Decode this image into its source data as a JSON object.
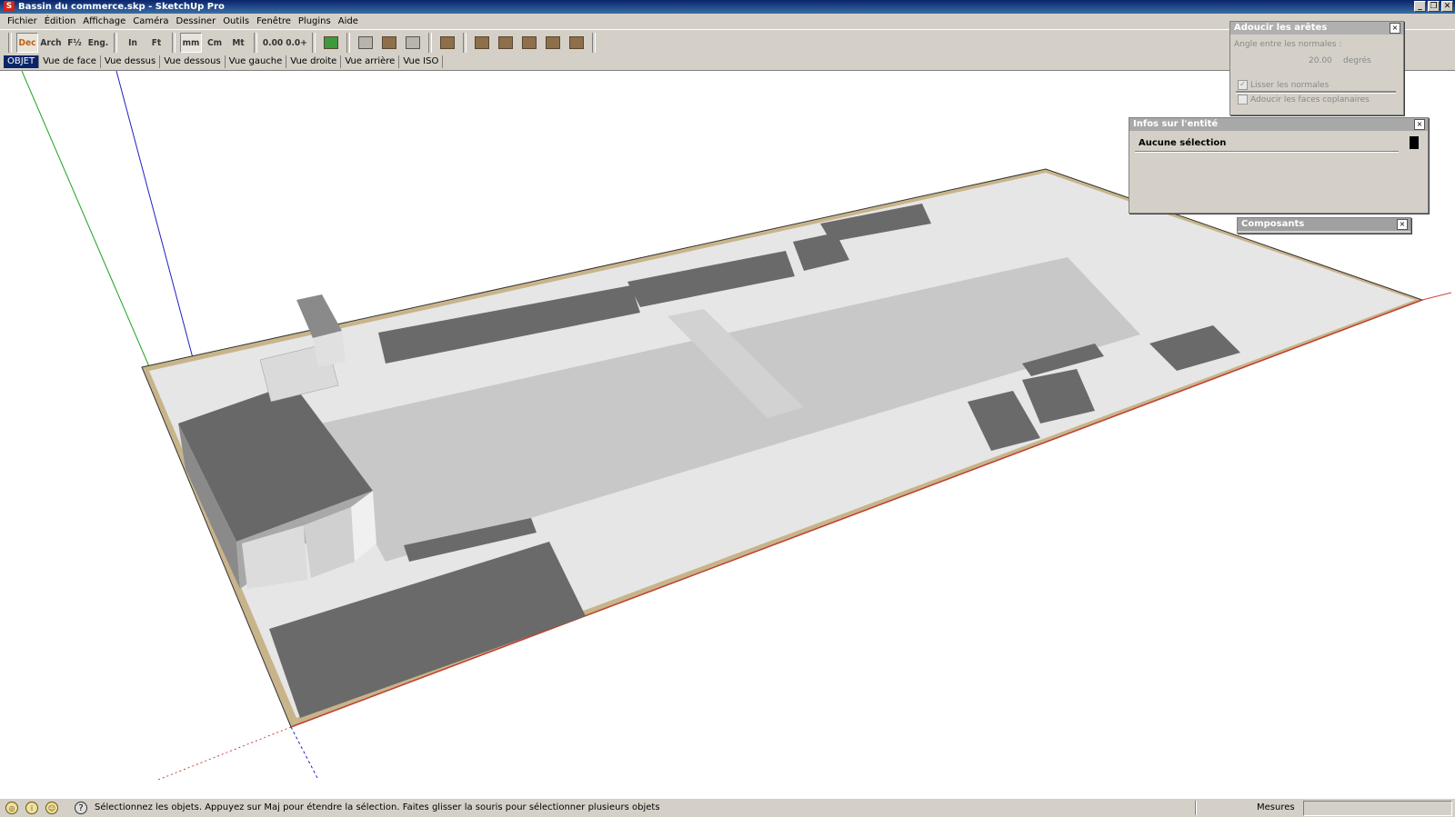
{
  "window": {
    "title": "Bassin du commerce.skp - SketchUp Pro"
  },
  "menu": [
    "Fichier",
    "Édition",
    "Affichage",
    "Caméra",
    "Dessiner",
    "Outils",
    "Fenêtre",
    "Plugins",
    "Aide"
  ],
  "toolbar": {
    "units": [
      {
        "label": "Dec",
        "active": true
      },
      {
        "label": "Arch"
      },
      {
        "label": "F½"
      },
      {
        "label": "Eng."
      },
      {
        "label": "In"
      },
      {
        "label": "Ft"
      },
      {
        "label": "mm",
        "active": true
      },
      {
        "label": "Cm"
      },
      {
        "label": "Mt"
      },
      {
        "label": "0.00"
      },
      {
        "label": "0.0+"
      }
    ]
  },
  "scenes": [
    "OBJET",
    "Vue de face",
    "Vue dessus",
    "Vue dessous",
    "Vue gauche",
    "Vue droite",
    "Vue arrière",
    "Vue ISO"
  ],
  "soften_panel": {
    "title": "Adoucir les arêtes",
    "angle_label": "Angle entre les normales :",
    "angle_value": "20.00",
    "angle_unit": "degrés",
    "smooth_normals": "Lisser les normales",
    "soften_coplanar": "Adoucir les faces coplanaires",
    "smooth_checked": true,
    "coplanar_checked": false
  },
  "entity_panel": {
    "title": "Infos sur l'entité",
    "selection": "Aucune sélection"
  },
  "components_panel": {
    "title": "Composants"
  },
  "status": {
    "message": "Sélectionnez les objets. Appuyez sur Maj pour étendre la sélection. Faites glisser la souris pour sélectionner plusieurs objets",
    "measure_label": "Mesures"
  },
  "colors": {
    "selection": "#0a246a",
    "panel_bg": "#d4d0c8",
    "red_axis": "#d04040",
    "green_axis": "#20a020",
    "blue_axis": "#2020c0"
  }
}
